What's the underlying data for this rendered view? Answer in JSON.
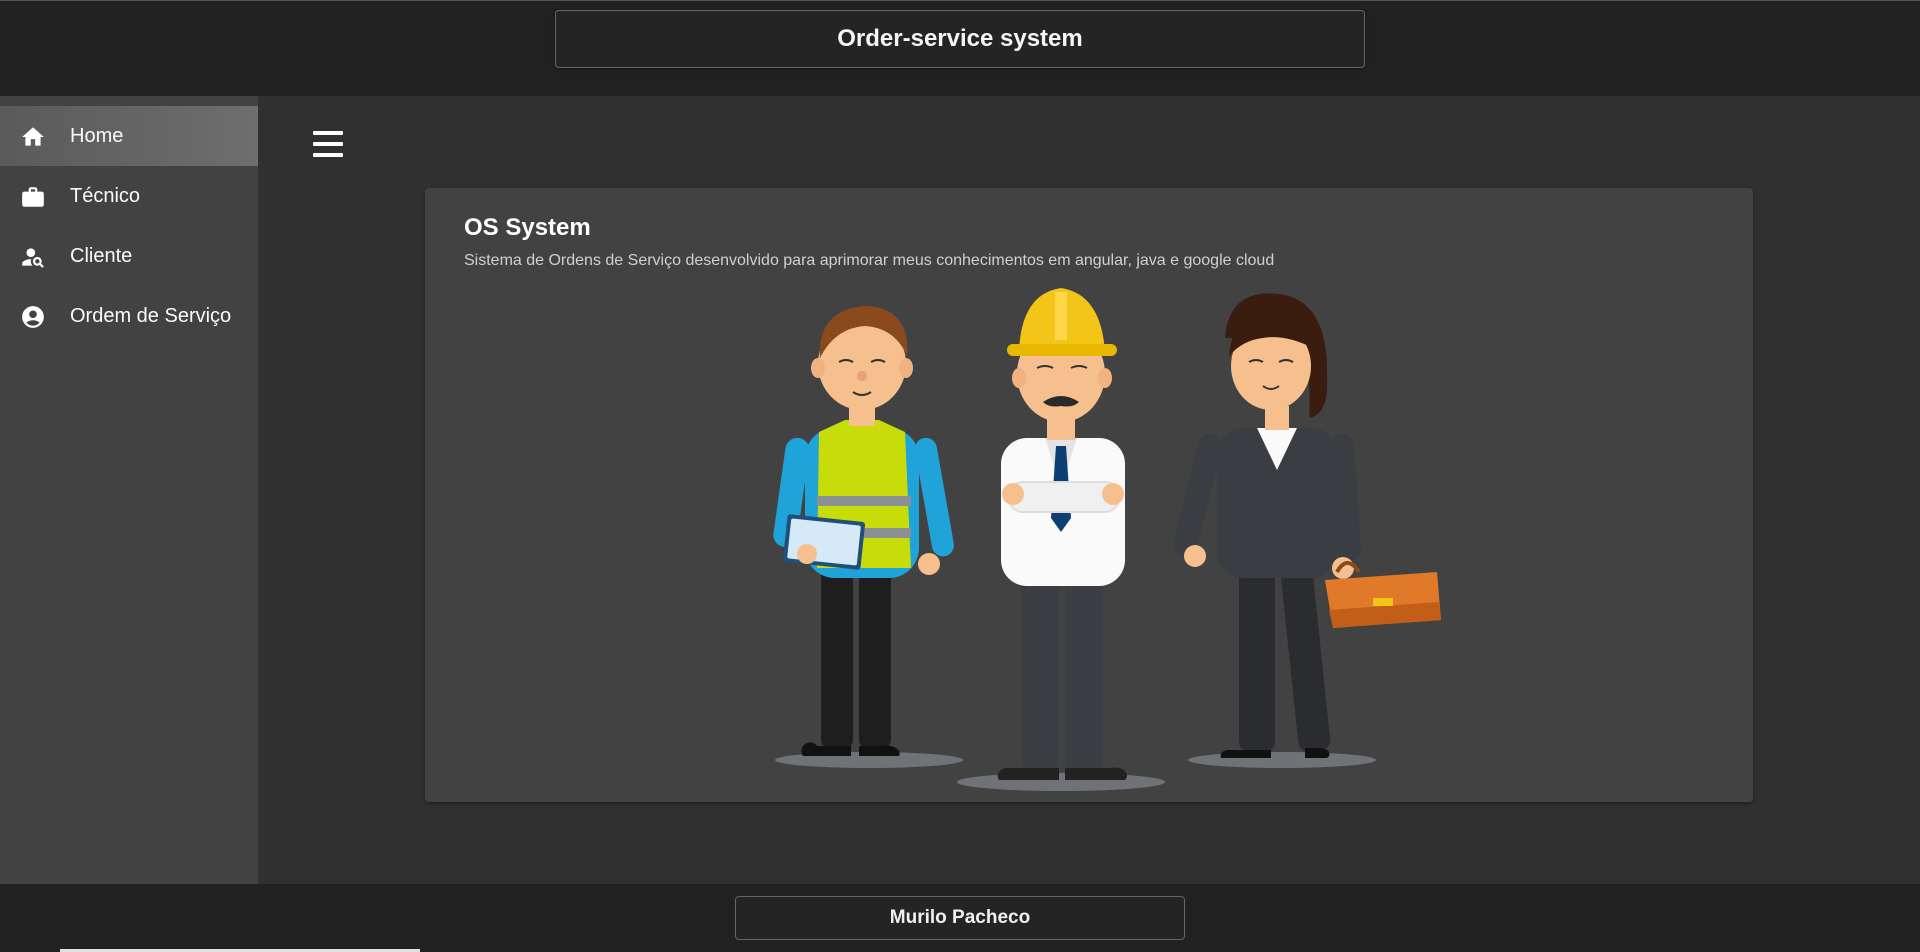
{
  "header": {
    "title": "Order-service system"
  },
  "sidebar": {
    "items": [
      {
        "label": "Home",
        "icon": "home-icon",
        "active": true
      },
      {
        "label": "Técnico",
        "icon": "briefcase-icon",
        "active": false
      },
      {
        "label": "Cliente",
        "icon": "person-search-icon",
        "active": false
      },
      {
        "label": "Ordem de Serviço",
        "icon": "account-circle-icon",
        "active": false
      }
    ]
  },
  "main": {
    "menu_icon": "hamburger-menu-icon",
    "card": {
      "title": "OS System",
      "subtitle": "Sistema de Ordens de Serviço desenvolvido para aprimorar meus conhecimentos em angular, java e google cloud"
    }
  },
  "footer": {
    "author": "Murilo Pacheco"
  },
  "colors": {
    "topbar": "#212121",
    "sidebar": "#424242",
    "main_bg": "#303030",
    "card_bg": "#424242",
    "active_item": "#666666"
  }
}
